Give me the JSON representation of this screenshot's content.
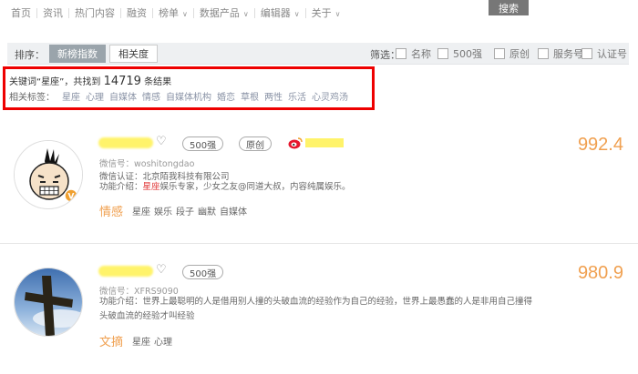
{
  "nav": {
    "items": [
      {
        "label": "首页",
        "caret": false
      },
      {
        "label": "资讯",
        "caret": false
      },
      {
        "label": "热门内容",
        "caret": false
      },
      {
        "label": "融资",
        "caret": false
      },
      {
        "label": "榜单",
        "caret": true
      },
      {
        "label": "数据产品",
        "caret": true
      },
      {
        "label": "编辑器",
        "caret": true
      },
      {
        "label": "关于",
        "caret": true
      }
    ],
    "search_label": "搜索"
  },
  "filterbar": {
    "sort_label": "排序：",
    "tabs": [
      "新榜指数",
      "相关度"
    ],
    "filter_label": "筛选：",
    "filters": [
      "名称",
      "500强",
      "原创",
      "服务号",
      "认证号"
    ]
  },
  "keywords": {
    "prefix": "关键词",
    "keyword": "“星座”",
    "found": "，共找到",
    "count": "14719",
    "suffix": "条结果",
    "tags_label": "相关标签：",
    "tags": [
      "星座",
      "心理",
      "自媒体",
      "情感",
      "自媒体机构",
      "婚恋",
      "草根",
      "两性",
      "乐活",
      "心灵鸡汤"
    ]
  },
  "results": [
    {
      "badges": [
        "500强",
        "原创"
      ],
      "wechat_id": "微信号：woshitongdao",
      "verify": "微信认证：北京陌我科技有限公司",
      "intro_prefix": "功能介绍：",
      "intro_hl": "星座",
      "intro_rest": "娱乐专家，少女之友@同道大叔，内容纯属娱乐。",
      "category": "情感",
      "tags": [
        "星座",
        "娱乐",
        "段子",
        "幽默",
        "自媒体"
      ],
      "score": "992.4"
    },
    {
      "badges": [
        "500强"
      ],
      "wechat_id": "微信号：XFRS9090",
      "intro_prefix": "功能介绍：",
      "intro_line1": "世界上最聪明的人是借用别人撞的头破血流的经验作为自己的经验，世界上最愚蠢的人是非用自己撞得",
      "intro_line2": "头破血流的经验才叫经验",
      "category": "文摘",
      "tags": [
        "星座",
        "心理"
      ],
      "score": "980.9"
    }
  ],
  "colors": {
    "accent": "#f0a050",
    "highlight_box": "#e00000",
    "keyword_highlight": "#e03a3a"
  }
}
